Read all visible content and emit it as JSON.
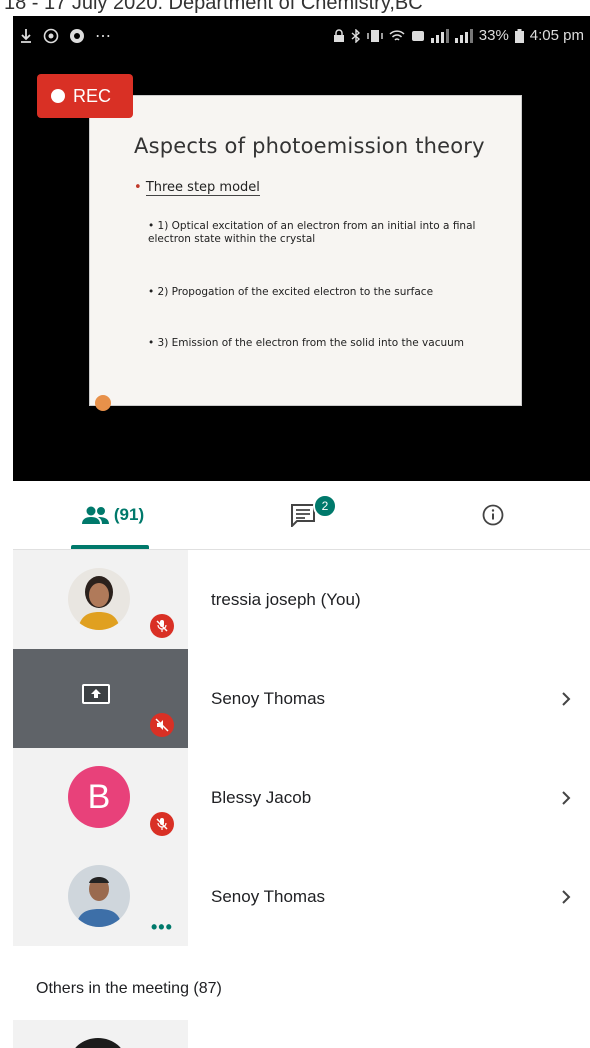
{
  "caption": "18 - 17 July 2020. Department of Chemistry,BC",
  "status_bar": {
    "battery": "33%",
    "time": "4:05 pm"
  },
  "recording": {
    "label": "REC"
  },
  "slide": {
    "title": "Aspects of photoemission theory",
    "bullet": "Three step model",
    "sub_bullets": [
      "1) Optical excitation of an electron from an initial into a final electron state within the crystal",
      "2) Propogation of the excited electron to the surface",
      "3) Emission of the electron from the solid into the vacuum"
    ]
  },
  "tabs": {
    "people_count": "(91)",
    "chat_badge": "2"
  },
  "participants": [
    {
      "name": "tressia joseph (You)"
    },
    {
      "name": "Senoy Thomas"
    },
    {
      "name": "Blessy Jacob",
      "initial": "B"
    },
    {
      "name": "Senoy Thomas"
    }
  ],
  "others_header": "Others in the meeting (87)",
  "colors": {
    "accent": "#00796b",
    "rec": "#d93025",
    "avatar_b": "#e8417a"
  }
}
